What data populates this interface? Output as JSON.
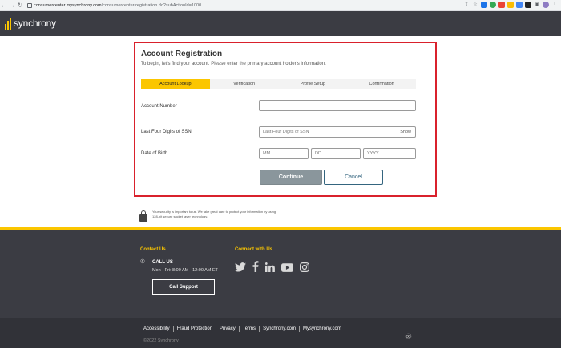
{
  "browser": {
    "url_host": "consumercenter.mysynchrony.com",
    "url_path": "/consumercenter/registration.do?subActionId=1000"
  },
  "header": {
    "logo_text": "synchrony",
    "brand_color": "#fbc600",
    "background_color": "#3b3c43"
  },
  "registration": {
    "title": "Account Registration",
    "subtitle": "To begin, let's find your account. Please enter the primary account holder's information.",
    "steps": [
      {
        "label": "Account Lookup",
        "active": true
      },
      {
        "label": "Verification",
        "active": false
      },
      {
        "label": "Profile Setup",
        "active": false
      },
      {
        "label": "Confirmation",
        "active": false
      }
    ],
    "account_number": {
      "label": "Account Number",
      "value": "",
      "placeholder": ""
    },
    "ssn": {
      "label": "Last Four Digits of SSN",
      "placeholder": "Last Four Digits of SSN",
      "show_label": "Show"
    },
    "dob": {
      "label": "Date of Birth",
      "mm_placeholder": "MM",
      "dd_placeholder": "DD",
      "yyyy_placeholder": "YYYY"
    },
    "continue_label": "Continue",
    "cancel_label": "Cancel",
    "highlight_color": "#d9212c"
  },
  "security_note": {
    "text": "Your security is important to us. We take great care to protect your information by using 128-bit secure socket layer technology."
  },
  "footer": {
    "contact_heading": "Contact Us",
    "connect_heading": "Connect with Us",
    "call_title": "CALL US",
    "call_hours": "Mon - Fri: 8:00 AM - 12:00 AM ET",
    "call_button": "Call Support",
    "social_icons": [
      "twitter-icon",
      "facebook-icon",
      "linkedin-icon",
      "youtube-icon",
      "instagram-icon"
    ],
    "links": [
      "Accessibility",
      "Fraud Protection",
      "Privacy",
      "Terms",
      "Synchrony.com",
      "Mysynchrony.com"
    ],
    "copyright": "©2022 Synchrony"
  }
}
